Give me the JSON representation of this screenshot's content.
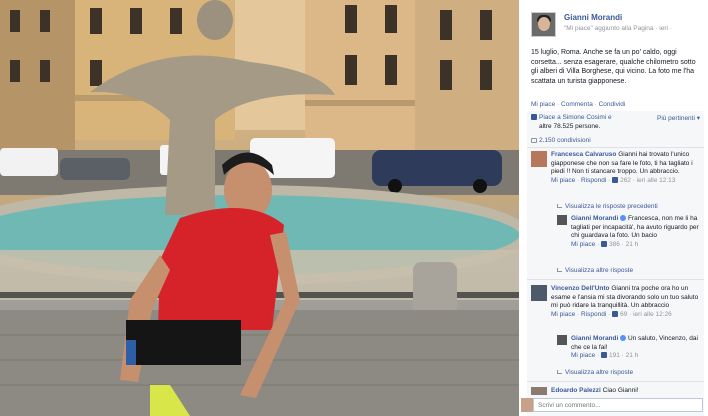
{
  "post": {
    "author": "Gianni Morandi",
    "meta": "\"Mi piace\" aggiunto alla Pagina · ieri ·",
    "text": "15 luglio, Roma. Anche se fa un po' caldo, oggi corsetta... senza esagerare, qualche chilometro sotto gli alberi di Villa Borghese, qui vicino. La foto me l'ha scattata un turista giapponese.",
    "actions": {
      "like": "Mi piace",
      "comment": "Commenta",
      "share": "Condividi"
    }
  },
  "likes": {
    "line1": "Piace a Simone Cosimi e",
    "line2": "altre 78.525 persone.",
    "more": "Più pertinenti ▾",
    "shares": "2.150 condivisioni"
  },
  "comments": [
    {
      "name": "Francesca Calvaruso",
      "text": "Gianni hai trovato l'unico giapponese che non sa fare le foto, ti ha tagliato i piedi !! Non ti stancare troppo. Un abbraccio.",
      "like": "Mi piace",
      "reply": "Rispondi",
      "count": "262",
      "time": "ieri alle 12:13",
      "prev_replies": "Visualizza le risposte precedenti",
      "reply_item": {
        "name": "Gianni Morandi",
        "text": "Francesca, non me li ha tagliati per incapacità', ha avuto riguardo per chi guardava la foto. Un bacio",
        "like": "Mi piace",
        "count": "386",
        "time": "21 h"
      },
      "more_replies": "Visualizza altre risposte"
    },
    {
      "name": "Vincenzo Dell'Unto",
      "text": "Gianni tra poche ora ho un esame e l'ansia mi sta divorando solo un tuo saluto mi può ridare la tranquillità. Un abbraccio",
      "like": "Mi piace",
      "reply": "Rispondi",
      "count": "69",
      "time": "ieri alle 12:26",
      "reply_item": {
        "name": "Gianni Morandi",
        "text": "Un saluto, Vincenzo, dai che ce la fai!",
        "like": "Mi piace",
        "count": "191",
        "time": "21 h"
      },
      "more_replies": "Visualizza altre risposte"
    },
    {
      "name": "Edoardo Palezzi",
      "text": "Ciao Gianni!"
    }
  ],
  "comment_input": {
    "placeholder": "Scrivi un commento..."
  },
  "colors": {
    "link": "#3b5998",
    "muted": "#90949c",
    "panel_bg": "#f6f7f9"
  }
}
